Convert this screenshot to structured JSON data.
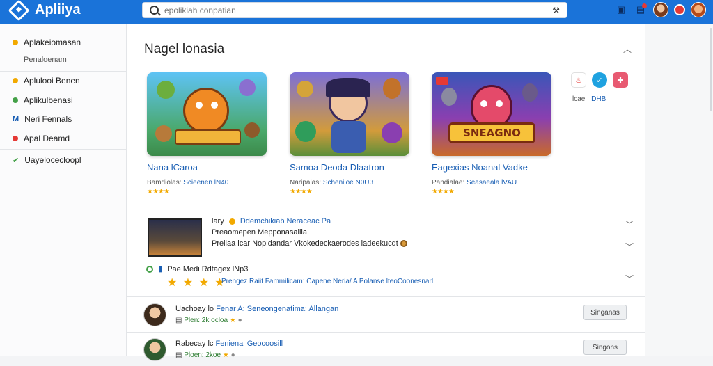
{
  "header": {
    "app_name": "Apliiya",
    "search_placeholder": "epolikiah conpatian"
  },
  "sidebar": {
    "items": [
      {
        "label": "Aplakeiomasan",
        "color": "#f2a900"
      },
      {
        "label": "Aplulooi Benen",
        "color": "#f2a900"
      },
      {
        "label": "Aplikulbenasi",
        "color": "#43a047"
      },
      {
        "label": "Neri Fennals",
        "color": "#1a5fb4"
      },
      {
        "label": "Apal Deamd",
        "color": "#e53935"
      },
      {
        "label": "Uayelocecloopl",
        "color": "#43a047"
      }
    ],
    "sub_label": "Penaloenam"
  },
  "main": {
    "section_title": "Nagel lonasia",
    "cards": [
      {
        "title": "Nana lCaroa",
        "meta_label": "Bamdiolas:",
        "meta_link": "Scieenen lN40",
        "stars": "★★★★"
      },
      {
        "title": "Samoa Deoda Dlaatron",
        "meta_label": "Naripalas:",
        "meta_link": "Scheniloe N0U3",
        "stars": "★★★★"
      },
      {
        "title": "Eagexias Noanal Vadke",
        "meta_label": "Pandialae:",
        "meta_link": "Seasaeala lVAU",
        "stars": "★★★★"
      }
    ],
    "game_banner_3": "SNEAGNO",
    "mini_caption": "lcae",
    "mini_caption_link": "DHB",
    "featured": {
      "line1_prefix": "lary",
      "line1_link": "Ddemchikiab Neraceac Pa",
      "line2": "Preaomepen Mepponasaiiia",
      "line3_a": "Preliaa icar",
      "line3_b": "Nopidandar",
      "line3_c": "Vkokedeckaerodes ladeekucdt"
    },
    "review": {
      "label": "Pae Medi Rdtagex lNp3",
      "link": "Prengez Raiit Fammilicam: Capene Neria/ A Polanse lteoCoonesnarl"
    },
    "rows": [
      {
        "name": "Uachoay lo",
        "name_link": "Fenar A: Seneongenatima: Allangan",
        "meta": "Plen: 2k ocloa",
        "button": "Singanas"
      },
      {
        "name": "Rabecay lc",
        "name_link": "Fenienal Geocoosill",
        "meta": "Ploen: 2koe",
        "button": "Singons"
      }
    ]
  }
}
